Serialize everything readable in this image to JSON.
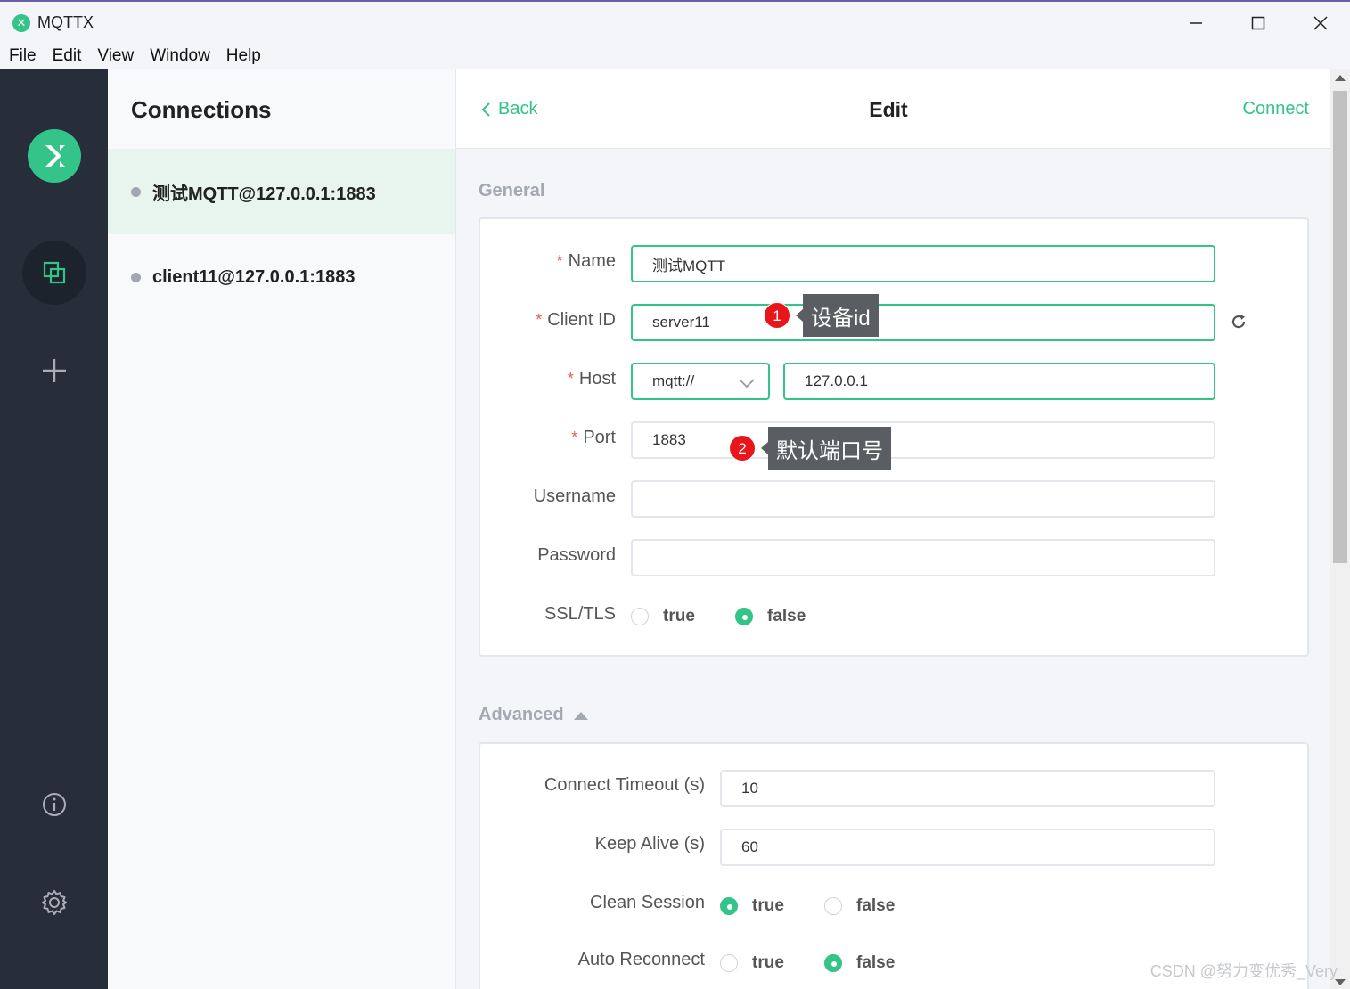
{
  "window": {
    "title": "MQTTX",
    "logo_glyph": "✕"
  },
  "menu": [
    "File",
    "Edit",
    "View",
    "Window",
    "Help"
  ],
  "rail": {
    "icons": [
      "mqttx-logo-icon",
      "connections-icon",
      "plus-icon",
      "info-icon",
      "gear-icon"
    ]
  },
  "connections": {
    "title": "Connections",
    "items": [
      {
        "label": "测试MQTT@127.0.0.1:1883",
        "active": true
      },
      {
        "label": "client11@127.0.0.1:1883",
        "active": false
      }
    ]
  },
  "header": {
    "back": "Back",
    "title": "Edit",
    "connect": "Connect"
  },
  "general": {
    "title": "General",
    "name": {
      "label": "Name",
      "value": "测试MQTT"
    },
    "client_id": {
      "label": "Client ID",
      "value": "server11"
    },
    "host": {
      "label": "Host",
      "protocol": "mqtt://",
      "value": "127.0.0.1"
    },
    "port": {
      "label": "Port",
      "value": "1883"
    },
    "username": {
      "label": "Username",
      "value": ""
    },
    "password": {
      "label": "Password",
      "value": ""
    },
    "ssl": {
      "label": "SSL/TLS",
      "options": [
        "true",
        "false"
      ],
      "selected": "false"
    }
  },
  "annotations": [
    {
      "number": "1",
      "text": "设备id"
    },
    {
      "number": "2",
      "text": "默认端口号"
    }
  ],
  "advanced": {
    "title": "Advanced",
    "connect_timeout": {
      "label": "Connect Timeout (s)",
      "value": "10"
    },
    "keep_alive": {
      "label": "Keep Alive (s)",
      "value": "60"
    },
    "clean_session": {
      "label": "Clean Session",
      "options": [
        "true",
        "false"
      ],
      "selected": "true"
    },
    "auto_reconnect": {
      "label": "Auto Reconnect",
      "options": [
        "true",
        "false"
      ],
      "selected": "false"
    }
  },
  "watermark": "CSDN @努力变优秀_Very",
  "colors": {
    "accent": "#34c388",
    "rail": "#282e39",
    "badge": "#e8161a",
    "tooltip": "#5a5d61"
  }
}
